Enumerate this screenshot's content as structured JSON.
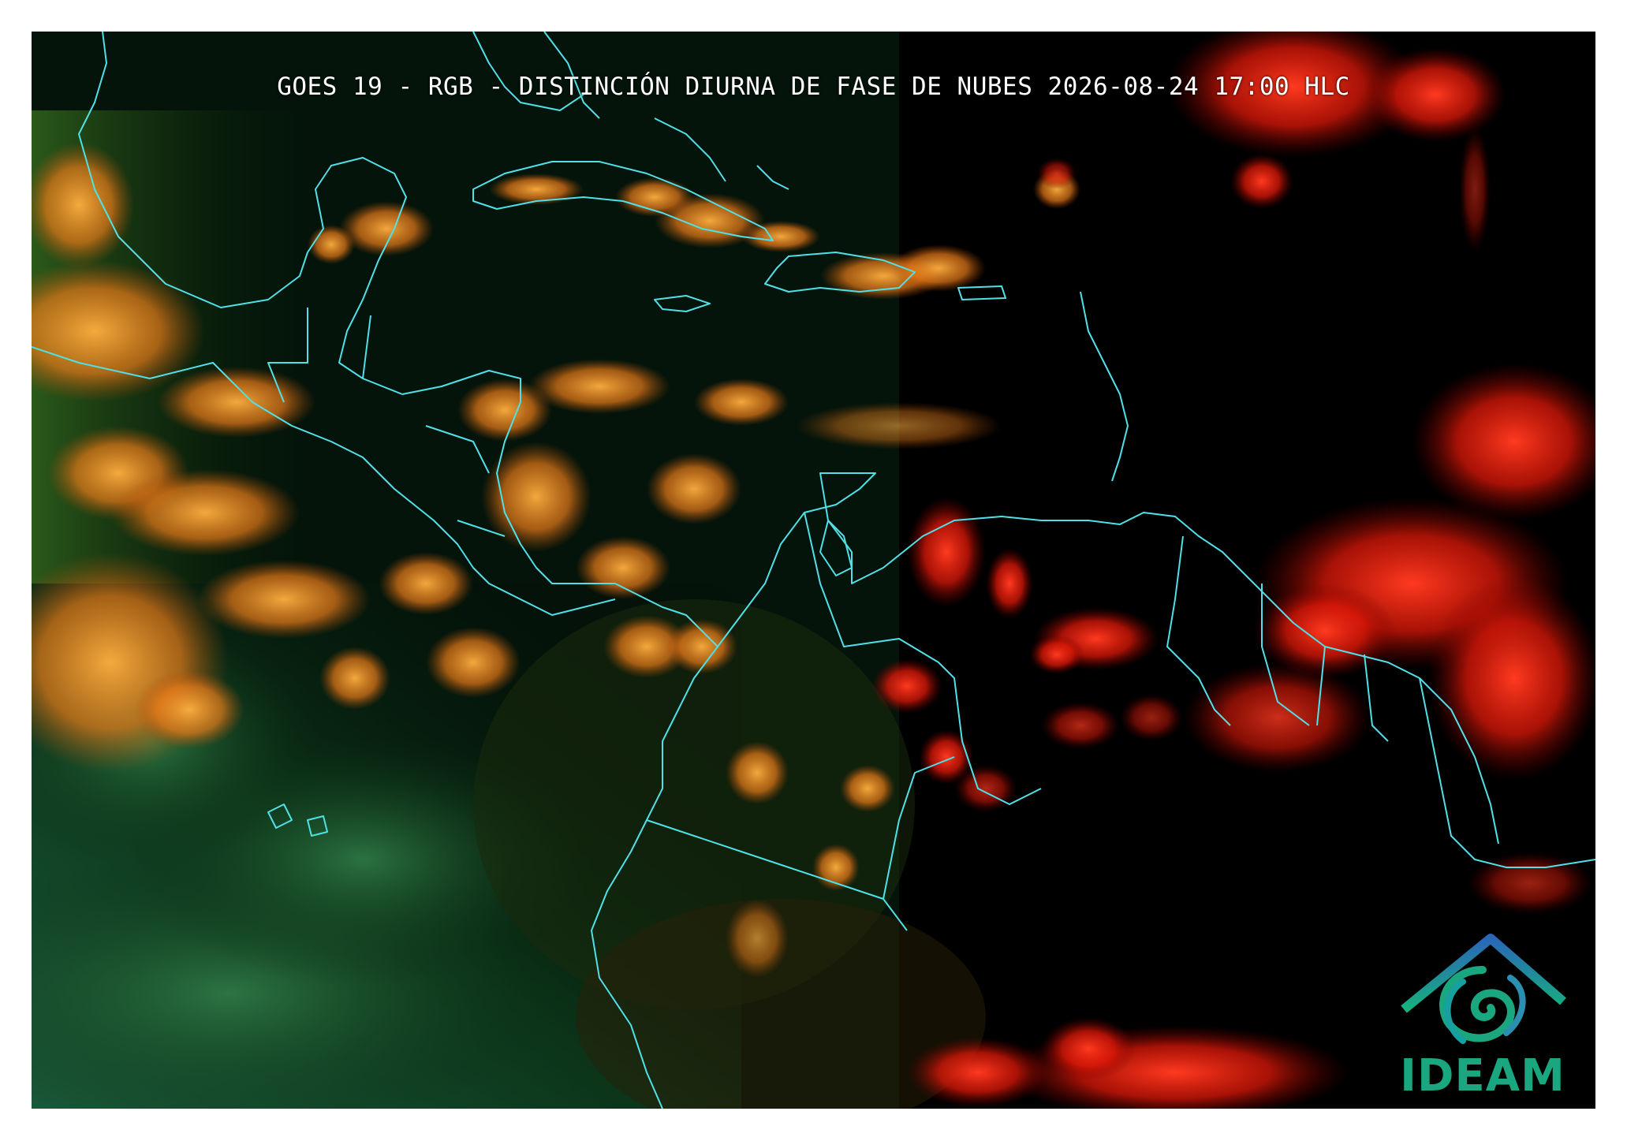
{
  "map": {
    "title": "GOES 19 - RGB - DISTINCIÓN DIURNA DE FASE DE NUBES 2026-08-24 17:00 HLC",
    "logo_text": "IDEAM",
    "colors": {
      "background": "#000000",
      "land_dark": "#0a2a10",
      "ocean_green": "#0f4a2a",
      "cloud_orange": "#f08a20",
      "cloud_red": "#ff2010",
      "coastline": "#4fe0e8",
      "logo_blue": "#2a6fb5",
      "logo_green": "#1aa77f"
    },
    "icons": {
      "logo": "ideam-logo-icon"
    }
  }
}
